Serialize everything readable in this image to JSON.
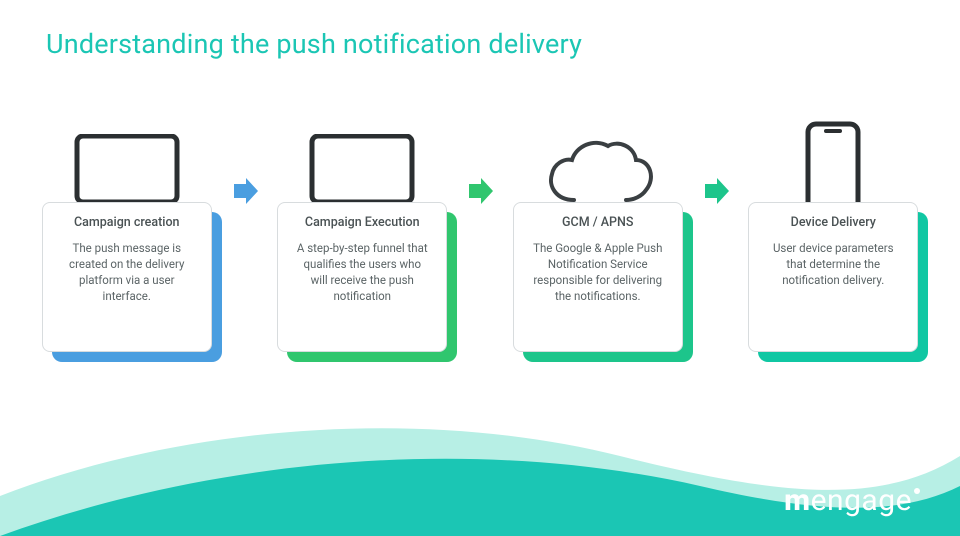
{
  "title": "Understanding the push notification delivery",
  "steps": [
    {
      "title": "Campaign creation",
      "desc": "The push message is created on the delivery platform via a user interface.",
      "icon": "laptop",
      "shadow": "sh-blue"
    },
    {
      "title": "Campaign Execution",
      "desc": "A step-by-step funnel that qualifies the users who will receive the push notification",
      "icon": "laptop",
      "shadow": "sh-green1"
    },
    {
      "title": "GCM / APNS",
      "desc": "The Google & Apple Push Notification Service responsible for delivering the notifications.",
      "icon": "cloud",
      "shadow": "sh-green2"
    },
    {
      "title": "Device Delivery",
      "desc": "User device parameters that determine the notification delivery.",
      "icon": "phone",
      "shadow": "sh-green3"
    }
  ],
  "arrows": [
    {
      "color": "#4a9ee0"
    },
    {
      "color": "#30c66e"
    },
    {
      "color": "#1dc58b"
    }
  ],
  "brand": {
    "part1": "m",
    "part2": "engage"
  },
  "colors": {
    "title": "#1bc6b4",
    "wave_back": "#b7efe5",
    "wave_front": "#1bc6b4"
  }
}
